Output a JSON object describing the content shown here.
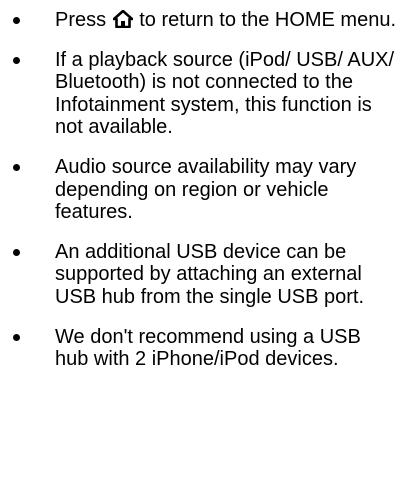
{
  "bullets": [
    {
      "before": "Press ",
      "icon": "home-icon",
      "after": " to return to the HOME menu."
    },
    {
      "text": "If a playback source (iPod/ USB/ AUX/ Bluetooth) is not connected to the Infotainment system, this function is not available."
    },
    {
      "text": "Audio source availability may vary depending on region or vehicle features."
    },
    {
      "text": "An additional USB device can be supported by attaching an external USB hub from the single USB port."
    },
    {
      "text": "We don't recommend using a USB hub with 2 iPhone/iPod devices."
    }
  ]
}
